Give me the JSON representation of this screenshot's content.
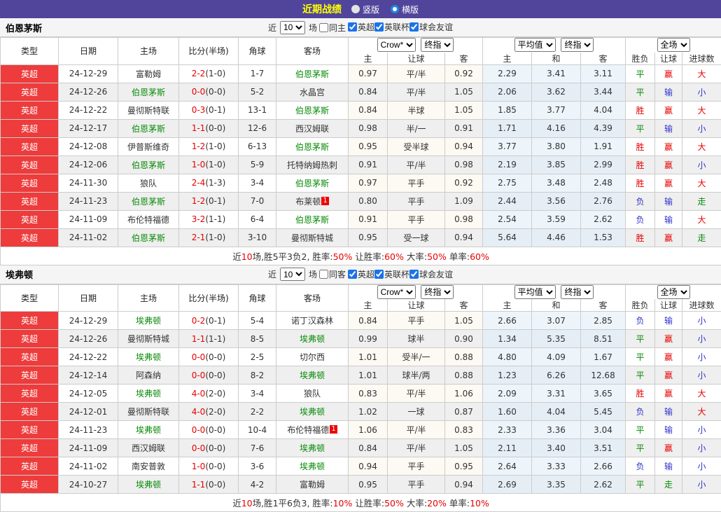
{
  "topbar": {
    "title": "近期战绩",
    "radios": [
      {
        "label": "竖版",
        "selected": false
      },
      {
        "label": "横版",
        "selected": true
      }
    ]
  },
  "cols": {
    "type": "类型",
    "date": "日期",
    "home": "主场",
    "score": "比分(半场)",
    "corner": "角球",
    "away": "客场",
    "odds_home": "主",
    "handicap": "让球",
    "odds_away": "客",
    "avg_home": "主",
    "avg_draw": "和",
    "avg_away": "客",
    "wdl": "胜负",
    "rh": "让球",
    "goals": "进球数"
  },
  "selects": {
    "crow": "Crow*",
    "final1": "终指",
    "avg": "平均值",
    "final2": "终指",
    "full": "全场"
  },
  "sections": [
    {
      "team": "伯恩茅斯",
      "filter": {
        "near": "近",
        "count": "10",
        "games": "场",
        "same_label": "同主",
        "same_checked": false,
        "leagues": [
          {
            "label": "英超",
            "checked": true
          },
          {
            "label": "英联杯",
            "checked": true
          },
          {
            "label": "球会友谊",
            "checked": true
          }
        ]
      },
      "rows": [
        {
          "type": "英超",
          "date": "24-12-29",
          "home": "富勒姆",
          "home_self": false,
          "score": "2-2",
          "half": "(1-0)",
          "corner": "1-7",
          "away": "伯恩茅斯",
          "away_self": true,
          "oh": "0.97",
          "hcp": "平/半",
          "oa": "0.92",
          "ah": "2.29",
          "ad": "3.41",
          "aa": "3.11",
          "wdl": {
            "t": "平",
            "c": "g"
          },
          "rh": {
            "t": "赢",
            "c": "r"
          },
          "goal": {
            "t": "大",
            "c": "r"
          }
        },
        {
          "type": "英超",
          "date": "24-12-26",
          "home": "伯恩茅斯",
          "home_self": true,
          "score": "0-0",
          "half": "(0-0)",
          "corner": "5-2",
          "away": "水晶宫",
          "away_self": false,
          "oh": "0.84",
          "hcp": "平/半",
          "oa": "1.05",
          "ah": "2.06",
          "ad": "3.62",
          "aa": "3.44",
          "wdl": {
            "t": "平",
            "c": "g"
          },
          "rh": {
            "t": "输",
            "c": "b"
          },
          "goal": {
            "t": "小",
            "c": "b"
          }
        },
        {
          "type": "英超",
          "date": "24-12-22",
          "home": "曼彻斯特联",
          "home_self": false,
          "score": "0-3",
          "half": "(0-1)",
          "corner": "13-1",
          "away": "伯恩茅斯",
          "away_self": true,
          "oh": "0.84",
          "hcp": "半球",
          "oa": "1.05",
          "ah": "1.85",
          "ad": "3.77",
          "aa": "4.04",
          "wdl": {
            "t": "胜",
            "c": "r"
          },
          "rh": {
            "t": "赢",
            "c": "r"
          },
          "goal": {
            "t": "大",
            "c": "r"
          }
        },
        {
          "type": "英超",
          "date": "24-12-17",
          "home": "伯恩茅斯",
          "home_self": true,
          "score": "1-1",
          "half": "(0-0)",
          "corner": "12-6",
          "away": "西汉姆联",
          "away_self": false,
          "oh": "0.98",
          "hcp": "半/一",
          "oa": "0.91",
          "ah": "1.71",
          "ad": "4.16",
          "aa": "4.39",
          "wdl": {
            "t": "平",
            "c": "g"
          },
          "rh": {
            "t": "输",
            "c": "b"
          },
          "goal": {
            "t": "小",
            "c": "b"
          }
        },
        {
          "type": "英超",
          "date": "24-12-08",
          "home": "伊普斯维奇",
          "home_self": false,
          "score": "1-2",
          "half": "(1-0)",
          "corner": "6-13",
          "away": "伯恩茅斯",
          "away_self": true,
          "oh": "0.95",
          "hcp": "受半球",
          "oa": "0.94",
          "ah": "3.77",
          "ad": "3.80",
          "aa": "1.91",
          "wdl": {
            "t": "胜",
            "c": "r"
          },
          "rh": {
            "t": "赢",
            "c": "r"
          },
          "goal": {
            "t": "大",
            "c": "r"
          }
        },
        {
          "type": "英超",
          "date": "24-12-06",
          "home": "伯恩茅斯",
          "home_self": true,
          "score": "1-0",
          "half": "(1-0)",
          "corner": "5-9",
          "away": "托特纳姆热刺",
          "away_self": false,
          "oh": "0.91",
          "hcp": "平/半",
          "oa": "0.98",
          "ah": "2.19",
          "ad": "3.85",
          "aa": "2.99",
          "wdl": {
            "t": "胜",
            "c": "r"
          },
          "rh": {
            "t": "赢",
            "c": "r"
          },
          "goal": {
            "t": "小",
            "c": "b"
          }
        },
        {
          "type": "英超",
          "date": "24-11-30",
          "home": "狼队",
          "home_self": false,
          "score": "2-4",
          "half": "(1-3)",
          "corner": "3-4",
          "away": "伯恩茅斯",
          "away_self": true,
          "oh": "0.97",
          "hcp": "平手",
          "oa": "0.92",
          "ah": "2.75",
          "ad": "3.48",
          "aa": "2.48",
          "wdl": {
            "t": "胜",
            "c": "r"
          },
          "rh": {
            "t": "赢",
            "c": "r"
          },
          "goal": {
            "t": "大",
            "c": "r"
          }
        },
        {
          "type": "英超",
          "date": "24-11-23",
          "home": "伯恩茅斯",
          "home_self": true,
          "score": "1-2",
          "half": "(0-1)",
          "corner": "7-0",
          "away": "布莱顿",
          "away_self": false,
          "badge": "1",
          "oh": "0.80",
          "hcp": "平手",
          "oa": "1.09",
          "ah": "2.44",
          "ad": "3.56",
          "aa": "2.76",
          "wdl": {
            "t": "负",
            "c": "b"
          },
          "rh": {
            "t": "输",
            "c": "b"
          },
          "goal": {
            "t": "走",
            "c": "g"
          }
        },
        {
          "type": "英超",
          "date": "24-11-09",
          "home": "布伦特福德",
          "home_self": false,
          "score": "3-2",
          "half": "(1-1)",
          "corner": "6-4",
          "away": "伯恩茅斯",
          "away_self": true,
          "oh": "0.91",
          "hcp": "平手",
          "oa": "0.98",
          "ah": "2.54",
          "ad": "3.59",
          "aa": "2.62",
          "wdl": {
            "t": "负",
            "c": "b"
          },
          "rh": {
            "t": "输",
            "c": "b"
          },
          "goal": {
            "t": "大",
            "c": "r"
          }
        },
        {
          "type": "英超",
          "date": "24-11-02",
          "home": "伯恩茅斯",
          "home_self": true,
          "score": "2-1",
          "half": "(1-0)",
          "corner": "3-10",
          "away": "曼彻斯特城",
          "away_self": false,
          "oh": "0.95",
          "hcp": "受一球",
          "oa": "0.94",
          "ah": "5.64",
          "ad": "4.46",
          "aa": "1.53",
          "wdl": {
            "t": "胜",
            "c": "r"
          },
          "rh": {
            "t": "赢",
            "c": "r"
          },
          "goal": {
            "t": "走",
            "c": "g"
          }
        }
      ],
      "summary": [
        {
          "t": "近",
          "c": "k"
        },
        {
          "t": "10",
          "c": "r"
        },
        {
          "t": "场,胜5平3负2, 胜率:",
          "c": "k"
        },
        {
          "t": "50%",
          "c": "r"
        },
        {
          "t": " 让胜率:",
          "c": "k"
        },
        {
          "t": "60%",
          "c": "r"
        },
        {
          "t": " 大率:",
          "c": "k"
        },
        {
          "t": "50%",
          "c": "r"
        },
        {
          "t": " 单率:",
          "c": "k"
        },
        {
          "t": "60%",
          "c": "r"
        }
      ]
    },
    {
      "team": "埃弗顿",
      "filter": {
        "near": "近",
        "count": "10",
        "games": "场",
        "same_label": "同客",
        "same_checked": false,
        "leagues": [
          {
            "label": "英超",
            "checked": true
          },
          {
            "label": "英联杯",
            "checked": true
          },
          {
            "label": "球会友谊",
            "checked": true
          }
        ]
      },
      "rows": [
        {
          "type": "英超",
          "date": "24-12-29",
          "home": "埃弗顿",
          "home_self": true,
          "score": "0-2",
          "half": "(0-1)",
          "corner": "5-4",
          "away": "诺丁汉森林",
          "away_self": false,
          "oh": "0.84",
          "hcp": "平手",
          "oa": "1.05",
          "ah": "2.66",
          "ad": "3.07",
          "aa": "2.85",
          "wdl": {
            "t": "负",
            "c": "b"
          },
          "rh": {
            "t": "输",
            "c": "b"
          },
          "goal": {
            "t": "小",
            "c": "b"
          }
        },
        {
          "type": "英超",
          "date": "24-12-26",
          "home": "曼彻斯特城",
          "home_self": false,
          "score": "1-1",
          "half": "(1-1)",
          "corner": "8-5",
          "away": "埃弗顿",
          "away_self": true,
          "oh": "0.99",
          "hcp": "球半",
          "oa": "0.90",
          "ah": "1.34",
          "ad": "5.35",
          "aa": "8.51",
          "wdl": {
            "t": "平",
            "c": "g"
          },
          "rh": {
            "t": "赢",
            "c": "r"
          },
          "goal": {
            "t": "小",
            "c": "b"
          }
        },
        {
          "type": "英超",
          "date": "24-12-22",
          "home": "埃弗顿",
          "home_self": true,
          "score": "0-0",
          "half": "(0-0)",
          "corner": "2-5",
          "away": "切尔西",
          "away_self": false,
          "oh": "1.01",
          "hcp": "受半/一",
          "oa": "0.88",
          "ah": "4.80",
          "ad": "4.09",
          "aa": "1.67",
          "wdl": {
            "t": "平",
            "c": "g"
          },
          "rh": {
            "t": "赢",
            "c": "r"
          },
          "goal": {
            "t": "小",
            "c": "b"
          }
        },
        {
          "type": "英超",
          "date": "24-12-14",
          "home": "阿森纳",
          "home_self": false,
          "score": "0-0",
          "half": "(0-0)",
          "corner": "8-2",
          "away": "埃弗顿",
          "away_self": true,
          "oh": "1.01",
          "hcp": "球半/两",
          "oa": "0.88",
          "ah": "1.23",
          "ad": "6.26",
          "aa": "12.68",
          "wdl": {
            "t": "平",
            "c": "g"
          },
          "rh": {
            "t": "赢",
            "c": "r"
          },
          "goal": {
            "t": "小",
            "c": "b"
          }
        },
        {
          "type": "英超",
          "date": "24-12-05",
          "home": "埃弗顿",
          "home_self": true,
          "score": "4-0",
          "half": "(2-0)",
          "corner": "3-4",
          "away": "狼队",
          "away_self": false,
          "oh": "0.83",
          "hcp": "平/半",
          "oa": "1.06",
          "ah": "2.09",
          "ad": "3.31",
          "aa": "3.65",
          "wdl": {
            "t": "胜",
            "c": "r"
          },
          "rh": {
            "t": "赢",
            "c": "r"
          },
          "goal": {
            "t": "大",
            "c": "r"
          }
        },
        {
          "type": "英超",
          "date": "24-12-01",
          "home": "曼彻斯特联",
          "home_self": false,
          "score": "4-0",
          "half": "(2-0)",
          "corner": "2-2",
          "away": "埃弗顿",
          "away_self": true,
          "oh": "1.02",
          "hcp": "一球",
          "oa": "0.87",
          "ah": "1.60",
          "ad": "4.04",
          "aa": "5.45",
          "wdl": {
            "t": "负",
            "c": "b"
          },
          "rh": {
            "t": "输",
            "c": "b"
          },
          "goal": {
            "t": "大",
            "c": "r"
          }
        },
        {
          "type": "英超",
          "date": "24-11-23",
          "home": "埃弗顿",
          "home_self": true,
          "score": "0-0",
          "half": "(0-0)",
          "corner": "10-4",
          "away": "布伦特福德",
          "away_self": false,
          "badge": "1",
          "oh": "1.06",
          "hcp": "平/半",
          "oa": "0.83",
          "ah": "2.33",
          "ad": "3.36",
          "aa": "3.04",
          "wdl": {
            "t": "平",
            "c": "g"
          },
          "rh": {
            "t": "输",
            "c": "b"
          },
          "goal": {
            "t": "小",
            "c": "b"
          }
        },
        {
          "type": "英超",
          "date": "24-11-09",
          "home": "西汉姆联",
          "home_self": false,
          "score": "0-0",
          "half": "(0-0)",
          "corner": "7-6",
          "away": "埃弗顿",
          "away_self": true,
          "oh": "0.84",
          "hcp": "平/半",
          "oa": "1.05",
          "ah": "2.11",
          "ad": "3.40",
          "aa": "3.51",
          "wdl": {
            "t": "平",
            "c": "g"
          },
          "rh": {
            "t": "赢",
            "c": "r"
          },
          "goal": {
            "t": "小",
            "c": "b"
          }
        },
        {
          "type": "英超",
          "date": "24-11-02",
          "home": "南安普敦",
          "home_self": false,
          "score": "1-0",
          "half": "(0-0)",
          "corner": "3-6",
          "away": "埃弗顿",
          "away_self": true,
          "oh": "0.94",
          "hcp": "平手",
          "oa": "0.95",
          "ah": "2.64",
          "ad": "3.33",
          "aa": "2.66",
          "wdl": {
            "t": "负",
            "c": "b"
          },
          "rh": {
            "t": "输",
            "c": "b"
          },
          "goal": {
            "t": "小",
            "c": "b"
          }
        },
        {
          "type": "英超",
          "date": "24-10-27",
          "home": "埃弗顿",
          "home_self": true,
          "score": "1-1",
          "half": "(0-0)",
          "corner": "4-2",
          "away": "富勒姆",
          "away_self": false,
          "oh": "0.95",
          "hcp": "平手",
          "oa": "0.94",
          "ah": "2.69",
          "ad": "3.35",
          "aa": "2.62",
          "wdl": {
            "t": "平",
            "c": "g"
          },
          "rh": {
            "t": "走",
            "c": "g"
          },
          "goal": {
            "t": "小",
            "c": "b"
          }
        }
      ],
      "summary": [
        {
          "t": "近",
          "c": "k"
        },
        {
          "t": "10",
          "c": "r"
        },
        {
          "t": "场,胜1平6负3, 胜率:",
          "c": "k"
        },
        {
          "t": "10%",
          "c": "r"
        },
        {
          "t": " 让胜率:",
          "c": "k"
        },
        {
          "t": "50%",
          "c": "r"
        },
        {
          "t": " 大率:",
          "c": "k"
        },
        {
          "t": "20%",
          "c": "r"
        },
        {
          "t": " 单率:",
          "c": "k"
        },
        {
          "t": "10%",
          "c": "r"
        }
      ]
    }
  ]
}
